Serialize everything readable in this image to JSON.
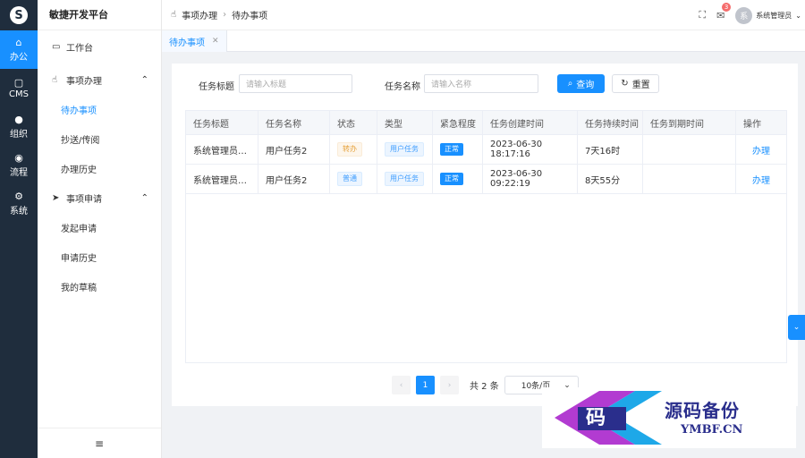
{
  "rail": {
    "items": [
      {
        "label": "办公",
        "icon": "home-icon"
      },
      {
        "label": "CMS",
        "icon": "cms-icon"
      },
      {
        "label": "组织",
        "icon": "user-icon"
      },
      {
        "label": "流程",
        "icon": "flow-icon"
      },
      {
        "label": "系统",
        "icon": "gear-icon"
      }
    ]
  },
  "app": {
    "title": "敏捷开发平台"
  },
  "menu": {
    "workbench": "工作台",
    "group1": "事项办理",
    "group1_items": [
      "待办事项",
      "抄送/传阅",
      "办理历史"
    ],
    "group2": "事项申请",
    "group2_items": [
      "发起申请",
      "申请历史",
      "我的草稿"
    ],
    "collapse_icon": "≡"
  },
  "header": {
    "breadcrumb": [
      "事项办理",
      "待办事项"
    ],
    "notification_count": "3",
    "avatar_text": "系",
    "user_name": "系统管理员"
  },
  "tabs": [
    {
      "label": "待办事项"
    }
  ],
  "search": {
    "title_label": "任务标题",
    "title_placeholder": "请输入标题",
    "name_label": "任务名称",
    "name_placeholder": "请输入名称",
    "query_label": "查询",
    "reset_label": "重置"
  },
  "table": {
    "columns": [
      "任务标题",
      "任务名称",
      "状态",
      "类型",
      "紧急程度",
      "任务创建时间",
      "任务持续时间",
      "任务到期时间",
      "操作"
    ],
    "rows": [
      {
        "title": "系统管理员…",
        "name": "用户任务2",
        "status": "转办",
        "type": "用户任务",
        "urgency": "正常",
        "created": "2023-06-30 18:17:16",
        "duration": "7天16时",
        "due": "",
        "action": "办理"
      },
      {
        "title": "系统管理员…",
        "name": "用户任务2",
        "status": "普通",
        "type": "用户任务",
        "urgency": "正常",
        "created": "2023-06-30 09:22:19",
        "duration": "8天55分",
        "due": "",
        "action": "办理"
      }
    ]
  },
  "pagination": {
    "prev": "‹",
    "current": "1",
    "next": "›",
    "total": "共 2 条",
    "page_size": "10条/页"
  },
  "watermark": {
    "title": "源码备份",
    "url": "YMBF.CN",
    "glyph": "码"
  },
  "colors": {
    "primary": "#1890ff",
    "rail_bg": "#1f2d3d"
  }
}
